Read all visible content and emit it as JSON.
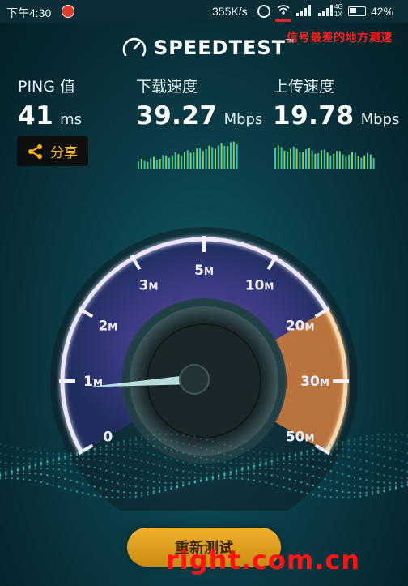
{
  "status_bar": {
    "time": "下午4:30",
    "net_speed": "355K/s",
    "net_type": "4G\n1X",
    "battery": "42%"
  },
  "annotation": "信号最差的地方测速",
  "logo": {
    "text": "SPEEDTEST",
    "tm": "TM"
  },
  "stats": {
    "ping": {
      "label": "PING 值",
      "value": "41",
      "unit": "ms"
    },
    "download": {
      "label": "下载速度",
      "value": "39.27",
      "unit": "Mbps"
    },
    "upload": {
      "label": "上传速度",
      "value": "19.78",
      "unit": "Mbps"
    }
  },
  "share_label": "分享",
  "gauge": {
    "ticks": [
      "0",
      "1M",
      "2M",
      "3M",
      "5M",
      "10M",
      "20M",
      "30M",
      "50M"
    ],
    "needle_value": "0.9M"
  },
  "retest_label": "重新测试",
  "watermark": "right.com.cn",
  "colors": {
    "accent": "#ffb600",
    "gauge_purple": "#8b6bd6",
    "gauge_orange": "#d98a3a",
    "spark_green": "#8dd045",
    "spark_teal": "#2ec5c9",
    "annotation_red": "#ff2020"
  }
}
